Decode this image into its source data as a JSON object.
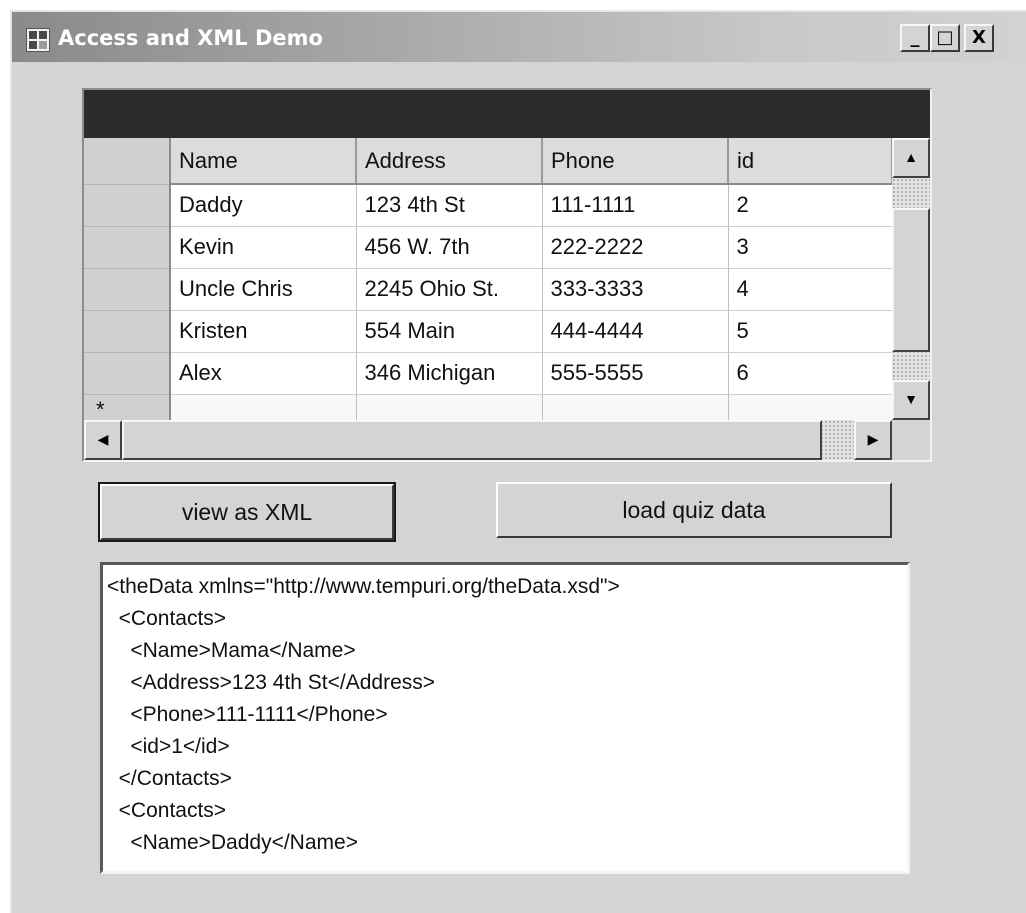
{
  "window": {
    "title": "Access and XML Demo",
    "controls": {
      "minimize": "_",
      "maximize": "□",
      "close": "X"
    }
  },
  "grid": {
    "columns": [
      "Name",
      "Address",
      "Phone",
      "id"
    ],
    "rows": [
      {
        "name": "Daddy",
        "address": "123 4th St",
        "phone": "111-1111",
        "id": "2"
      },
      {
        "name": "Kevin",
        "address": "456 W. 7th",
        "phone": "222-2222",
        "id": "3"
      },
      {
        "name": "Uncle Chris",
        "address": "2245 Ohio St.",
        "phone": "333-3333",
        "id": "4"
      },
      {
        "name": "Kristen",
        "address": "554 Main",
        "phone": "444-4444",
        "id": "5"
      },
      {
        "name": "Alex",
        "address": "346 Michigan",
        "phone": "555-5555",
        "id": "6"
      }
    ],
    "new_row_marker": "*"
  },
  "buttons": {
    "view_xml": "view as XML",
    "load_quiz": "load quiz data"
  },
  "xml_output": {
    "lines": [
      "<theData xmlns=\"http://www.tempuri.org/theData.xsd\">",
      "  <Contacts>",
      "    <Name>Mama</Name>",
      "    <Address>123 4th St</Address>",
      "    <Phone>111-1111</Phone>",
      "    <id>1</id>",
      "  </Contacts>",
      "  <Contacts>",
      "    <Name>Daddy</Name>"
    ]
  },
  "icons": {
    "scroll_up": "▲",
    "scroll_down": "▼",
    "scroll_left": "◀",
    "scroll_right": "▶"
  }
}
